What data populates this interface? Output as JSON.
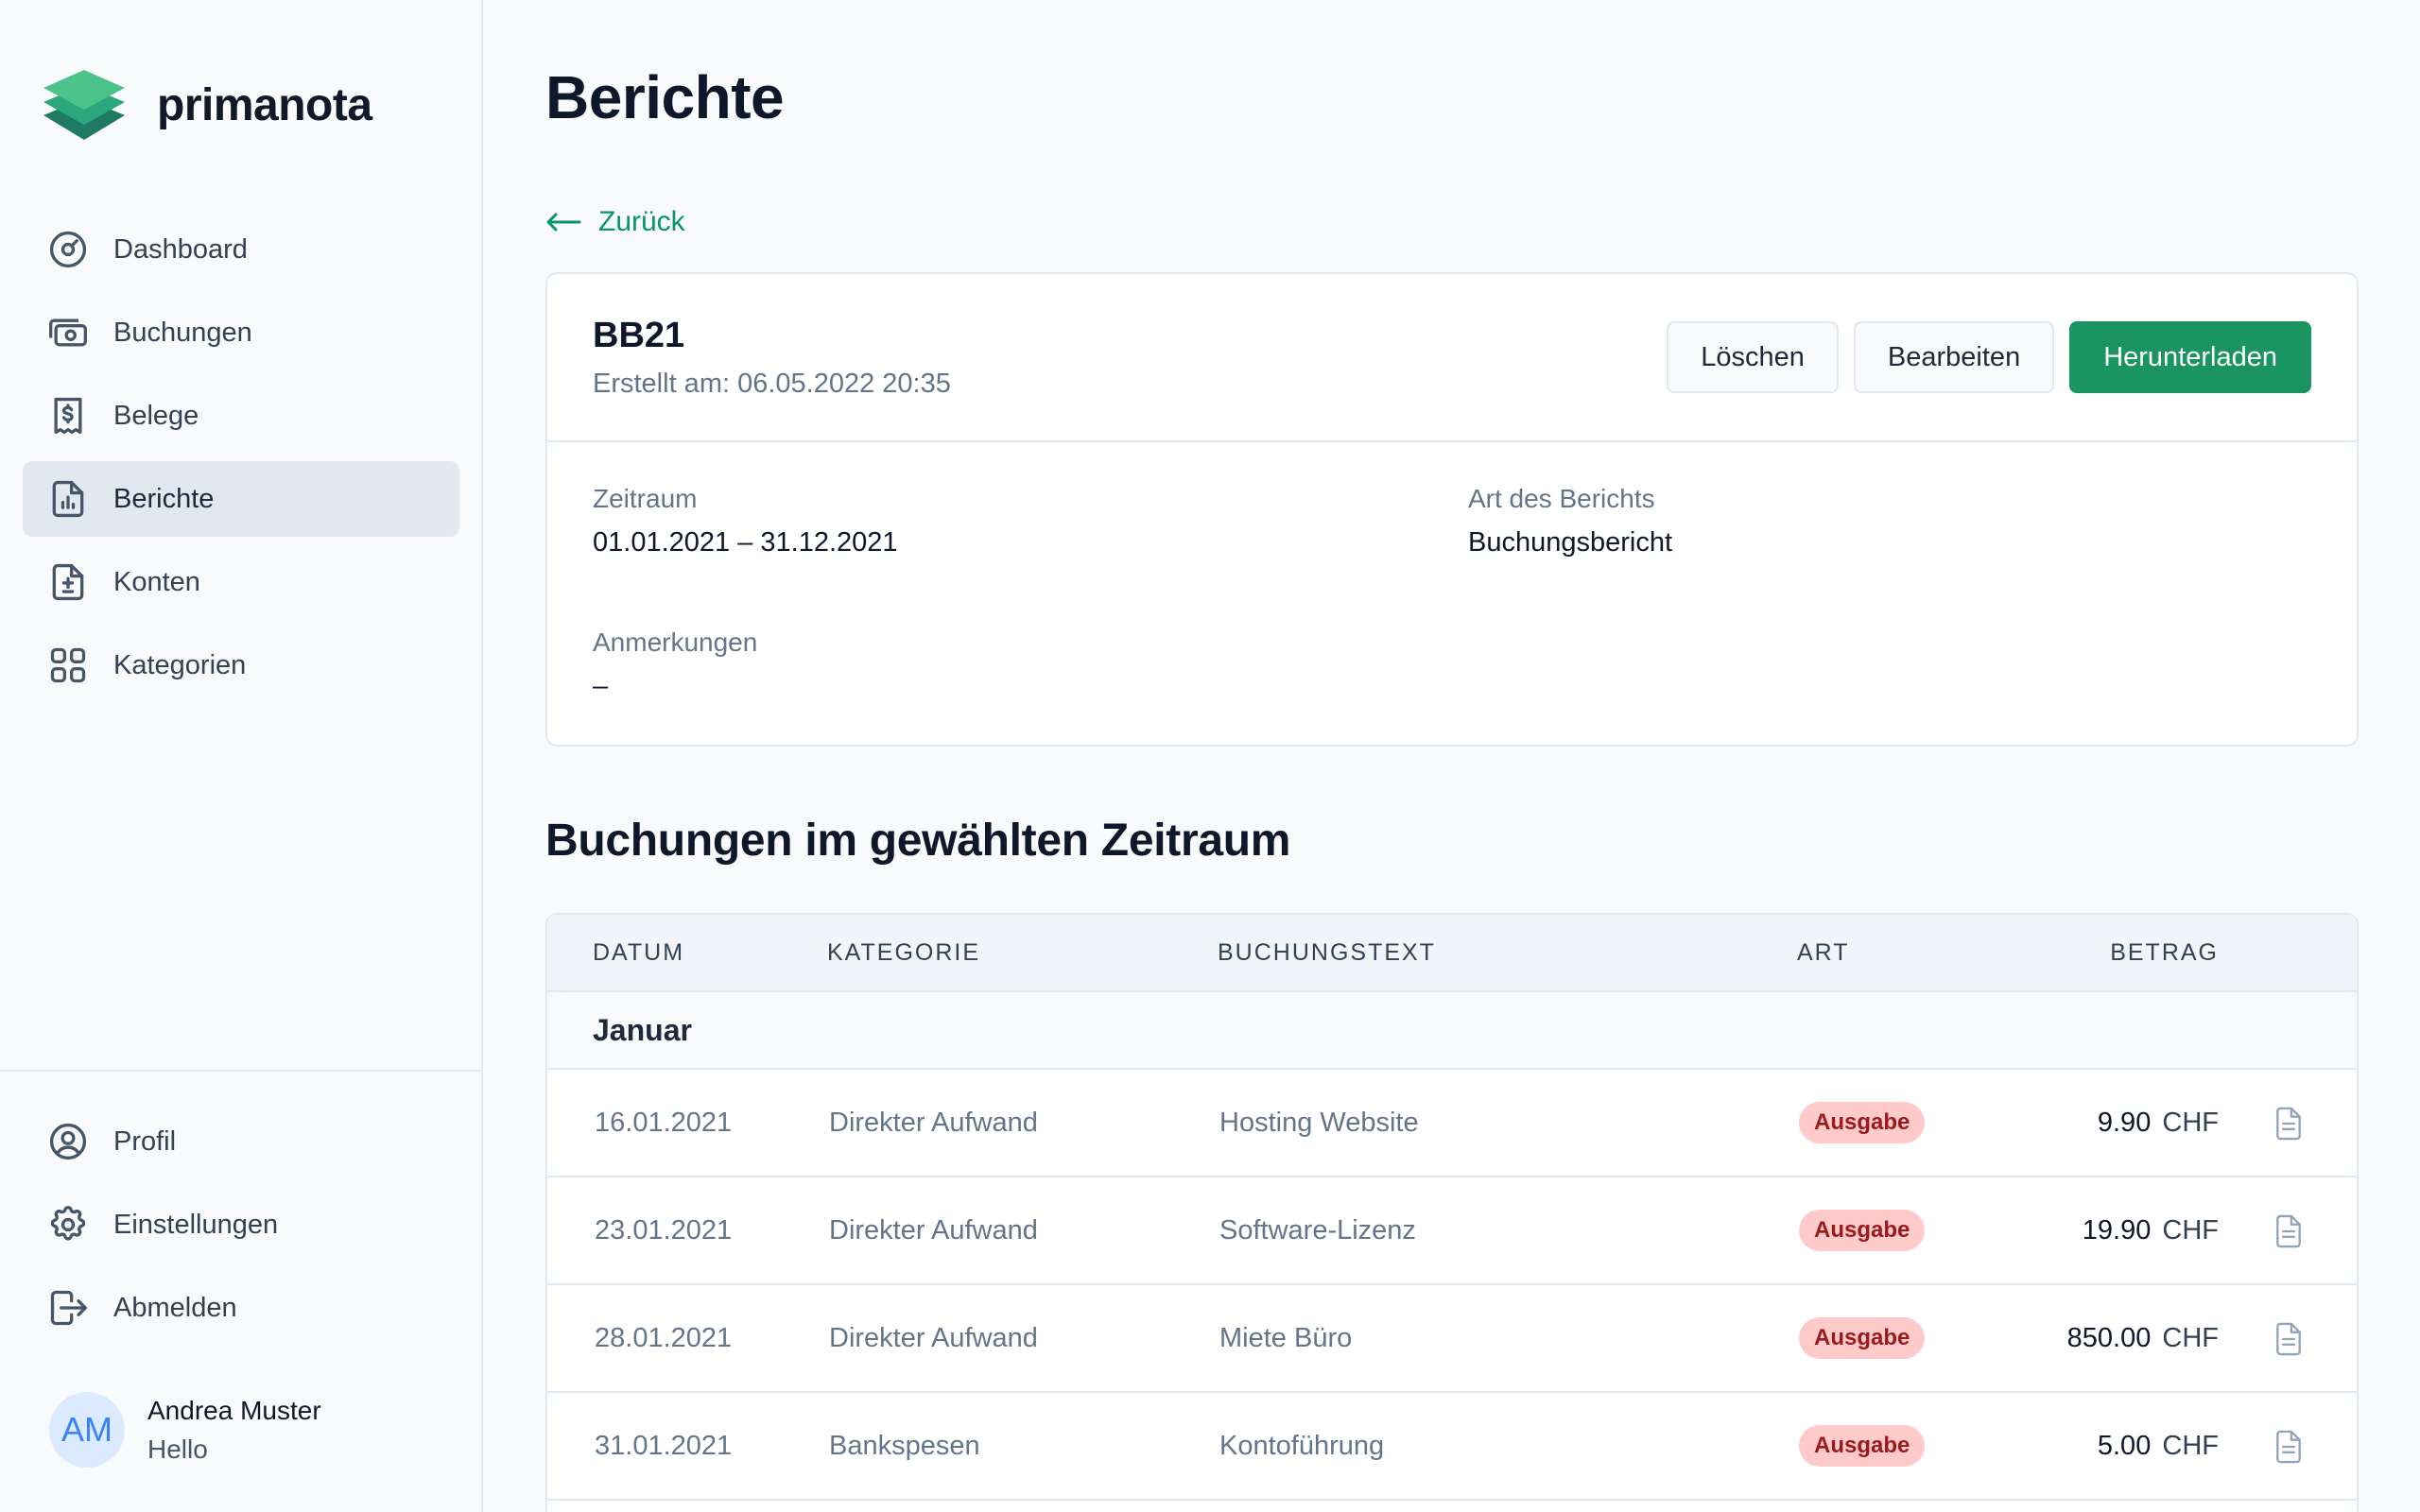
{
  "app": {
    "name": "primanota"
  },
  "sidebar": {
    "items": [
      {
        "label": "Dashboard",
        "icon": "gauge-icon"
      },
      {
        "label": "Buchungen",
        "icon": "cash-icon"
      },
      {
        "label": "Belege",
        "icon": "receipt-icon"
      },
      {
        "label": "Berichte",
        "icon": "report-icon",
        "active": true
      },
      {
        "label": "Konten",
        "icon": "document-plus-minus-icon"
      },
      {
        "label": "Kategorien",
        "icon": "grid-icon"
      }
    ],
    "bottom_items": [
      {
        "label": "Profil",
        "icon": "user-circle-icon"
      },
      {
        "label": "Einstellungen",
        "icon": "gear-icon"
      },
      {
        "label": "Abmelden",
        "icon": "logout-icon"
      }
    ],
    "user": {
      "initials": "AM",
      "name": "Andrea Muster",
      "subtitle": "Hello"
    }
  },
  "page": {
    "title": "Berichte",
    "back_label": "Zurück"
  },
  "report": {
    "id": "BB21",
    "created": "Erstellt am: 06.05.2022 20:35",
    "buttons": {
      "delete": "Löschen",
      "edit": "Bearbeiten",
      "download": "Herunterladen"
    },
    "fields": {
      "period_label": "Zeitraum",
      "period_value": "01.01.2021 – 31.12.2021",
      "type_label": "Art des Berichts",
      "type_value": "Buchungsbericht",
      "notes_label": "Anmerkungen",
      "notes_value": "–"
    }
  },
  "bookings": {
    "section_title": "Buchungen im gewählten Zeitraum",
    "columns": [
      "DATUM",
      "KATEGORIE",
      "BUCHUNGSTEXT",
      "ART",
      "BETRAG"
    ],
    "month": "Januar",
    "rows": [
      {
        "date": "16.01.2021",
        "category": "Direkter Aufwand",
        "text": "Hosting Website",
        "type": "Ausgabe",
        "amount": "9.90",
        "currency": "CHF"
      },
      {
        "date": "23.01.2021",
        "category": "Direkter Aufwand",
        "text": "Software-Lizenz",
        "type": "Ausgabe",
        "amount": "19.90",
        "currency": "CHF"
      },
      {
        "date": "28.01.2021",
        "category": "Direkter Aufwand",
        "text": "Miete Büro",
        "type": "Ausgabe",
        "amount": "850.00",
        "currency": "CHF"
      },
      {
        "date": "31.01.2021",
        "category": "Bankspesen",
        "text": "Kontoführung",
        "type": "Ausgabe",
        "amount": "5.00",
        "currency": "CHF"
      }
    ]
  },
  "colors": {
    "accent": "#1a9460",
    "link": "#059669",
    "badge_bg": "#fecaca",
    "badge_text": "#991b1b"
  }
}
